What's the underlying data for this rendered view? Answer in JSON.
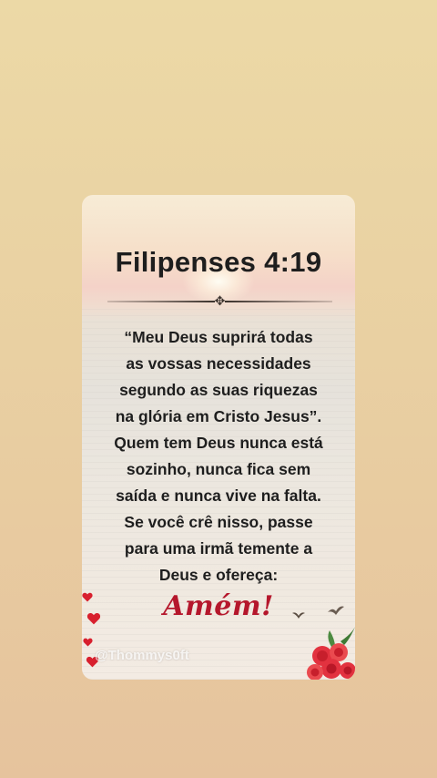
{
  "post": {
    "title": "Filipenses 4:19",
    "divider_ornament": "✥",
    "verse_lines": [
      "“Meu Deus suprirá todas",
      "as vossas necessidades",
      "segundo as suas riquezas",
      "na glória em Cristo Jesus”.",
      "Quem tem Deus nunca está",
      "sozinho, nunca fica sem",
      "saída e nunca vive na falta.",
      "Se você crê nisso, passe",
      "para uma irmã temente a",
      "Deus e ofereça:"
    ],
    "closing": "Amém!",
    "watermark": "@Thommys0ft"
  },
  "colors": {
    "title_text": "#1e1e1e",
    "closing_accent": "#b5172c",
    "heart": "#d8202e",
    "rose": "#e2323f"
  },
  "icons": {
    "divider": "ornament-icon",
    "hearts": "heart-icon",
    "birds": "bird-icon",
    "roses": "rose-bouquet-icon"
  }
}
